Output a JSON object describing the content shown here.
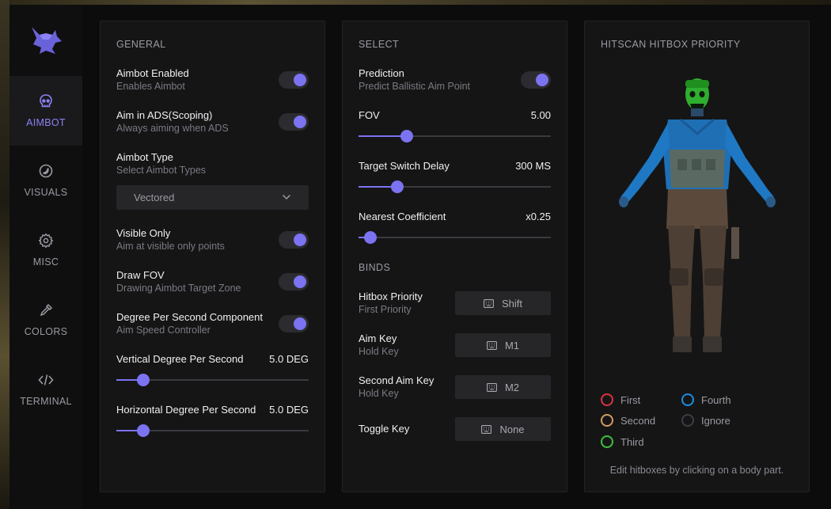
{
  "sidebar": {
    "items": [
      {
        "label": "AIMBOT",
        "icon": "skull-icon",
        "active": true
      },
      {
        "label": "VISUALS",
        "icon": "eye-icon",
        "active": false
      },
      {
        "label": "MISC",
        "icon": "gear-icon",
        "active": false
      },
      {
        "label": "COLORS",
        "icon": "eyedropper-icon",
        "active": false
      },
      {
        "label": "TERMINAL",
        "icon": "code-icon",
        "active": false
      }
    ]
  },
  "general": {
    "title": "GENERAL",
    "aimbot_enabled": {
      "label": "Aimbot Enabled",
      "sub": "Enables Aimbot",
      "on": true
    },
    "aim_ads": {
      "label": "Aim in ADS(Scoping)",
      "sub": "Always aiming when ADS",
      "on": true
    },
    "aimbot_type": {
      "label": "Aimbot Type",
      "sub": "Select Aimbot Types",
      "value": "Vectored"
    },
    "visible_only": {
      "label": "Visible Only",
      "sub": "Aim at visible only points",
      "on": true
    },
    "draw_fov": {
      "label": "Draw FOV",
      "sub": "Drawing Aimbot Target Zone",
      "on": true
    },
    "dps_component": {
      "label": "Degree Per Second Component",
      "sub": "Aim Speed Controller",
      "on": true
    },
    "vertical_dps": {
      "label": "Vertical Degree Per Second",
      "value": "5.0 DEG",
      "fraction": 0.14
    },
    "horizontal_dps": {
      "label": "Horizontal Degree Per Second",
      "value": "5.0 DEG",
      "fraction": 0.14
    }
  },
  "select": {
    "title": "SELECT",
    "prediction": {
      "label": "Prediction",
      "sub": "Predict Ballistic Aim Point",
      "on": true
    },
    "fov": {
      "label": "FOV",
      "value": "5.00",
      "fraction": 0.25
    },
    "switch_delay": {
      "label": "Target Switch Delay",
      "value": "300 MS",
      "fraction": 0.2
    },
    "nearest_coef": {
      "label": "Nearest Coefficient",
      "value": "x0.25",
      "fraction": 0.06
    }
  },
  "binds": {
    "title": "BINDS",
    "items": [
      {
        "label": "Hitbox Priority",
        "sub": "First Priority",
        "key": "Shift"
      },
      {
        "label": "Aim Key",
        "sub": "Hold Key",
        "key": "M1"
      },
      {
        "label": "Second Aim Key",
        "sub": "Hold Key",
        "key": "M2"
      },
      {
        "label": "Toggle Key",
        "sub": "",
        "key": "None"
      }
    ]
  },
  "hitbox": {
    "title": "HITSCAN HITBOX PRIORITY",
    "legend": [
      {
        "label": "First",
        "color": "#d8343f"
      },
      {
        "label": "Fourth",
        "color": "#1a8ee0"
      },
      {
        "label": "Second",
        "color": "#d29a62"
      },
      {
        "label": "Ignore",
        "color": "#3b3d48"
      },
      {
        "label": "Third",
        "color": "#3fbf3f"
      }
    ],
    "hint": "Edit hitboxes by clicking on a body part."
  },
  "colors": {
    "accent": "#7b73f0",
    "panel": "#151516",
    "bg": "#0c0c0d"
  }
}
